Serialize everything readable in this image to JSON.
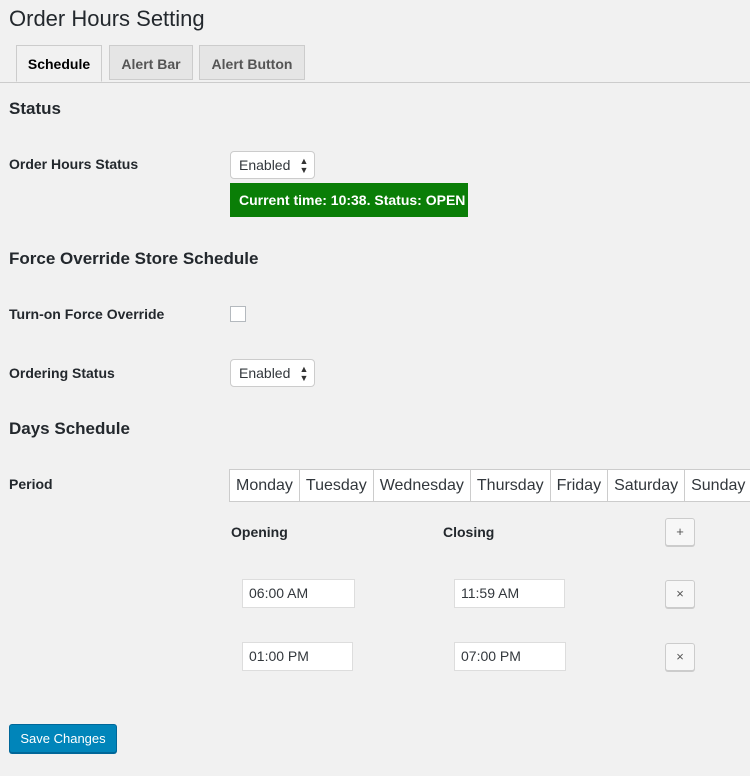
{
  "page": {
    "title": "Order Hours Setting"
  },
  "tabs": [
    {
      "label": "Schedule",
      "active": true
    },
    {
      "label": "Alert Bar",
      "active": false
    },
    {
      "label": "Alert Button",
      "active": false
    }
  ],
  "status": {
    "section_title": "Status",
    "order_hours_label": "Order Hours Status",
    "order_hours_value": "Enabled",
    "current_status_text": "Current time: 10:38. Status: OPEN",
    "status_color": "#0a7e07"
  },
  "force_override": {
    "section_title": "Force Override Store Schedule",
    "turn_on_label": "Turn-on Force Override",
    "turn_on_checked": false,
    "ordering_status_label": "Ordering Status",
    "ordering_status_value": "Enabled"
  },
  "days_schedule": {
    "section_title": "Days Schedule",
    "period_label": "Period",
    "days": [
      "Monday",
      "Tuesday",
      "Wednesday",
      "Thursday",
      "Friday",
      "Saturday",
      "Sunday"
    ],
    "opening_header": "Opening",
    "closing_header": "Closing",
    "add_button": "+",
    "remove_button": "×",
    "rows": [
      {
        "opening": "06:00 AM",
        "closing": "11:59 AM"
      },
      {
        "opening": "01:00 PM",
        "closing": "07:00 PM"
      }
    ]
  },
  "actions": {
    "save_label": "Save Changes",
    "accent_color": "#0085ba"
  }
}
